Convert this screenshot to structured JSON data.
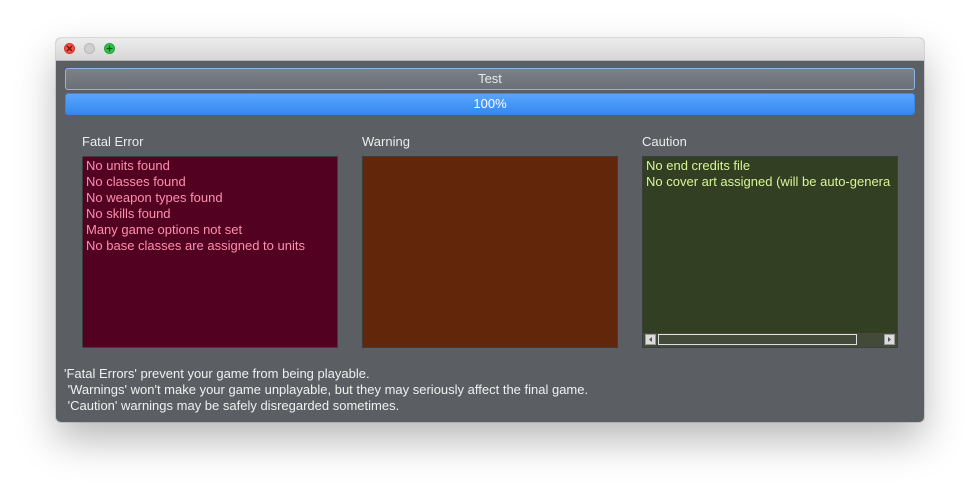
{
  "window": {
    "close_icon": "close-icon",
    "minimize_icon": "minimize-icon",
    "maximize_icon": "maximize-icon"
  },
  "test_button": {
    "label": "Test"
  },
  "progress": {
    "value": 1.0,
    "label": "100%"
  },
  "panels": {
    "fatal": {
      "title": "Fatal Error",
      "color": "#520220",
      "text_color": "#ff8fb0",
      "items": [
        "No units found",
        "No classes found",
        "No weapon types found",
        "No skills found",
        "Many game options not set",
        "No base classes are assigned to units"
      ]
    },
    "warning": {
      "title": "Warning",
      "color": "#62260a",
      "items": []
    },
    "caution": {
      "title": "Caution",
      "color": "#333f22",
      "text_color": "#d6f59a",
      "items": [
        "No end credits file",
        "No cover art assigned (will be auto-genera"
      ]
    }
  },
  "footer": {
    "lines": [
      "'Fatal Errors' prevent your game from being playable.",
      " 'Warnings' won't make your game unplayable, but they may seriously affect the final game.",
      " 'Caution' warnings may be safely disregarded sometimes."
    ]
  }
}
